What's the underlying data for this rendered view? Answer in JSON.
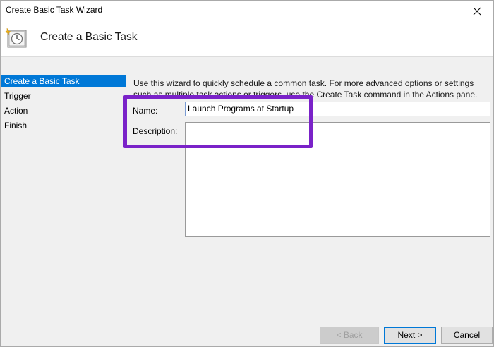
{
  "window": {
    "title": "Create Basic Task Wizard"
  },
  "header": {
    "title": "Create a Basic Task",
    "icon": "task-scheduler-clock-icon"
  },
  "sidebar": {
    "steps": [
      {
        "label": "Create a Basic Task",
        "active": true
      },
      {
        "label": "Trigger",
        "active": false
      },
      {
        "label": "Action",
        "active": false
      },
      {
        "label": "Finish",
        "active": false
      }
    ]
  },
  "main": {
    "intro": "Use this wizard to quickly schedule a common task.  For more advanced options or settings such as multiple task actions or triggers, use the Create Task command in the Actions pane.",
    "name_label": "Name:",
    "name_value": "Launch Programs at Startup",
    "description_label": "Description:",
    "description_value": ""
  },
  "buttons": {
    "back": "< Back",
    "next": "Next >",
    "cancel": "Cancel"
  },
  "colors": {
    "accent": "#0078d7",
    "highlight": "#7a22c8"
  }
}
